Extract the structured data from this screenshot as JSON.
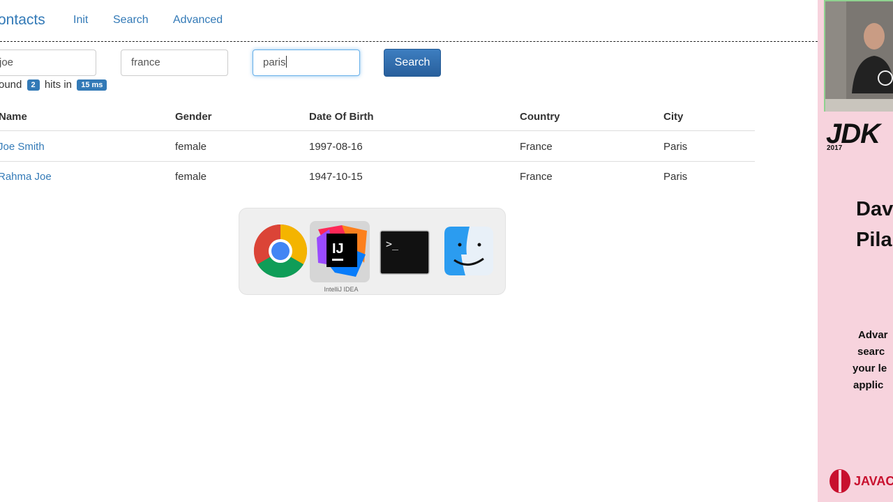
{
  "nav": {
    "brand": "ontacts",
    "links": [
      "Init",
      "Search",
      "Advanced"
    ]
  },
  "search_form": {
    "name_value": "joe",
    "country_value": "france",
    "city_value": "paris",
    "button_label": "Search"
  },
  "stats": {
    "prefix": "ound",
    "hits": "2",
    "middle": "hits in",
    "time": "15 ms"
  },
  "table": {
    "headers": [
      "Name",
      "Gender",
      "Date Of Birth",
      "Country",
      "City"
    ],
    "rows": [
      [
        "Joe Smith",
        "female",
        "1997-08-16",
        "France",
        "Paris"
      ],
      [
        "Rahma Joe",
        "female",
        "1947-10-15",
        "France",
        "Paris"
      ]
    ]
  },
  "app_switcher": {
    "apps": [
      "chrome-icon",
      "intellij-icon",
      "terminal-icon",
      "finder-icon"
    ],
    "selected_label": "IntelliJ IDEA"
  },
  "side_panel": {
    "logo": "JDK",
    "year": "2017",
    "speaker_lines": [
      "Dav",
      "Pila"
    ],
    "talk_lines": [
      "Advar",
      "searc",
      "your le",
      "applic"
    ],
    "sponsor": "JAVAC"
  },
  "colors": {
    "link": "#337ab7",
    "primary_button": "#2e6da4",
    "badge": "#337ab7",
    "side_background": "#f7d3dd"
  }
}
